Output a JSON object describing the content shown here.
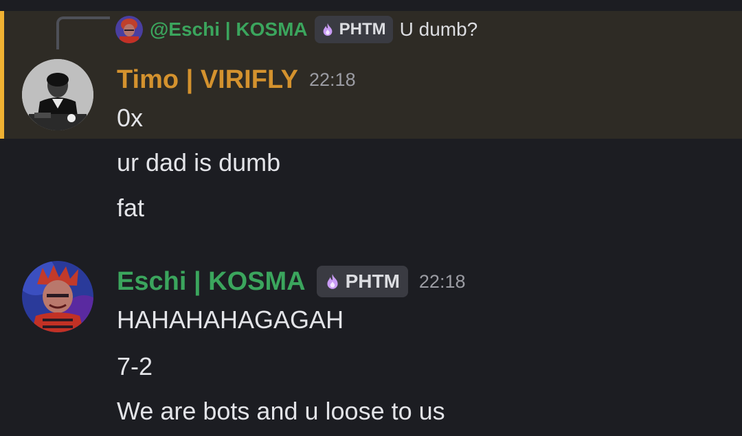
{
  "reply": {
    "author": "@Eschi | KOSMA",
    "role_badge": "PHTM",
    "text": "U dumb?"
  },
  "messages": [
    {
      "author": "Timo | VIRIFLY",
      "timestamp": "22:18",
      "avatar": "avatar-timo",
      "lines": [
        "0x",
        "ur dad is dumb",
        "fat"
      ]
    },
    {
      "author": "Eschi | KOSMA",
      "role_badge": "PHTM",
      "timestamp": "22:18",
      "avatar": "avatar-eschi",
      "lines": [
        "HAHAHAHAGAGAH",
        "7-2",
        "We are bots and u loose to us"
      ]
    }
  ],
  "colors": {
    "background": "#1c1d22",
    "mention_background": "#2e2b25",
    "mention_bar": "#f0b232",
    "timo_name": "#d4922e",
    "eschi_name": "#3ba55d",
    "badge_background": "#3a3b42",
    "badge_icon": "#c99cf5"
  },
  "icons": {
    "role_icon": "flame-icon"
  }
}
